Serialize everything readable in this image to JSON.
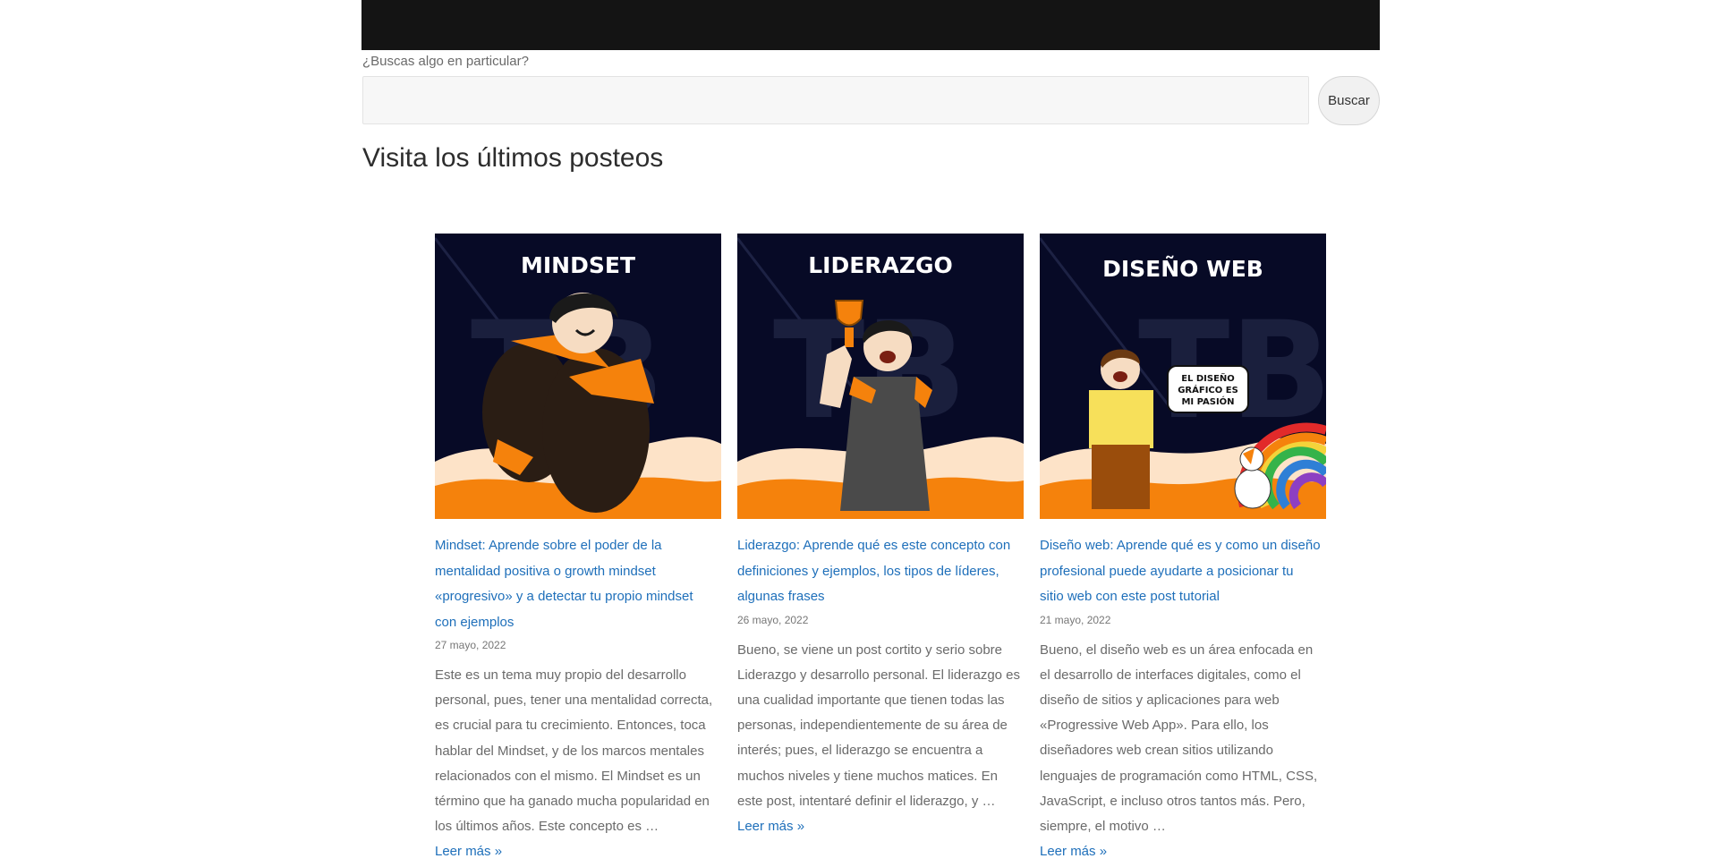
{
  "search": {
    "label": "¿Buscas algo en particular?",
    "placeholder": "",
    "value": "",
    "button_label": "Buscar"
  },
  "section": {
    "title": "Visita los últimos posteos"
  },
  "colors": {
    "link": "#1e6fba",
    "thumb_bg": "#070a26",
    "accent_orange": "#f5820c",
    "cream": "#fde3c8"
  },
  "posts": [
    {
      "image_caption": "MINDSET",
      "title": "Mindset: Aprende sobre el poder de la mentalidad positiva o growth mindset «progresivo» y a detectar tu propio mindset con ejemplos",
      "date": "27 mayo, 2022",
      "excerpt": "Este es un tema muy propio del desarrollo personal, pues, tener una mentalidad correcta, es crucial para tu crecimiento. Entonces, toca hablar del Mindset, y de los marcos mentales relacionados con el mismo. El Mindset es un término que ha ganado mucha popularidad en los últimos años. Este concepto es …",
      "read_more": "Leer más »"
    },
    {
      "image_caption": "LIDERAZGO",
      "title": "Liderazgo: Aprende qué es este concepto con definiciones y ejemplos, los tipos de líderes, algunas frases",
      "date": "26 mayo, 2022",
      "excerpt": "Bueno, se viene un post cortito y serio sobre Liderazgo y desarrollo personal. El liderazgo es una cualidad importante que tienen todas las personas, independientemente de su área de interés; pues, el liderazgo se encuentra a muchos niveles y tiene muchos matices. En este post, intentaré definir el liderazgo, y …",
      "read_more": "Leer más »"
    },
    {
      "image_caption": "DISEÑO WEB",
      "speech_bubble": "EL DISEÑO GRÁFICO ES MI PASIÓN",
      "title": "Diseño web: Aprende qué es y como un diseño profesional puede ayudarte a posicionar tu sitio web con este post tutorial",
      "date": "21 mayo, 2022",
      "excerpt": "Bueno, el diseño web es un área enfocada en el desarrollo de interfaces digitales, como el diseño de sitios y aplicaciones para web «Progressive Web App». Para ello, los diseñadores web crean sitios utilizando lenguajes de programación como HTML, CSS, JavaScript, e incluso otros tantos más. Pero, siempre, el motivo …",
      "read_more": "Leer más »"
    }
  ]
}
